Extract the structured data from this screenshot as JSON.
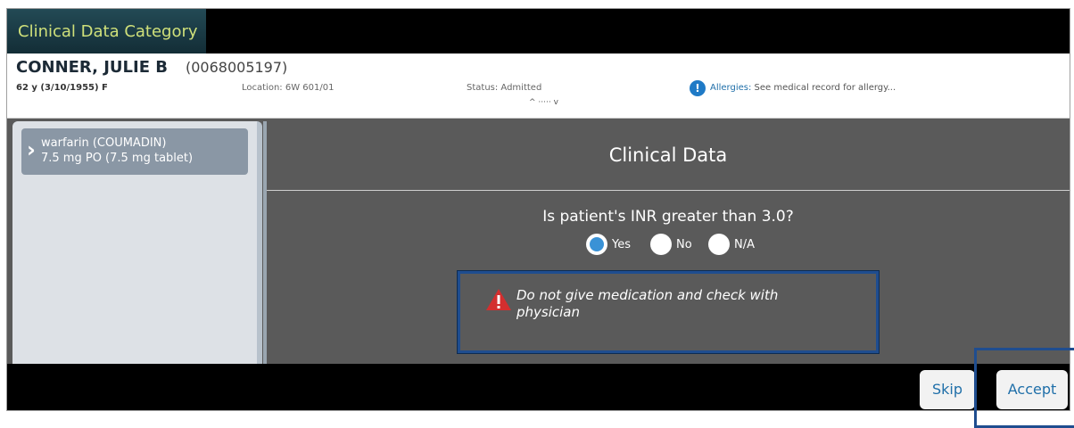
{
  "window": {
    "title": "Clinical Data Category"
  },
  "patient": {
    "name": "CONNER, JULIE B",
    "mrn": "(0068005197)",
    "demographics": "62 y (3/10/1955) F",
    "location": "Location: 6W 601/01",
    "status": "Status: Admitted",
    "allergies_label": "Allergies:",
    "allergies_text": "See medical record for allergy...",
    "expander": "^ ····· v"
  },
  "medication": {
    "line1": "warfarin (COUMADIN)",
    "line2": "7.5 mg PO (7.5 mg tablet)"
  },
  "clinical": {
    "title": "Clinical Data",
    "question": "Is patient's INR greater than 3.0?",
    "options": [
      "Yes",
      "No",
      "N/A"
    ],
    "selected": "Yes",
    "warning": "Do not give medication and check with physician"
  },
  "footer": {
    "skip_label": "Skip",
    "accept_label": "Accept"
  },
  "colors": {
    "accent": "#1f6fa9",
    "warning": "#d32f2f",
    "radio_selected": "#3a92d6"
  }
}
